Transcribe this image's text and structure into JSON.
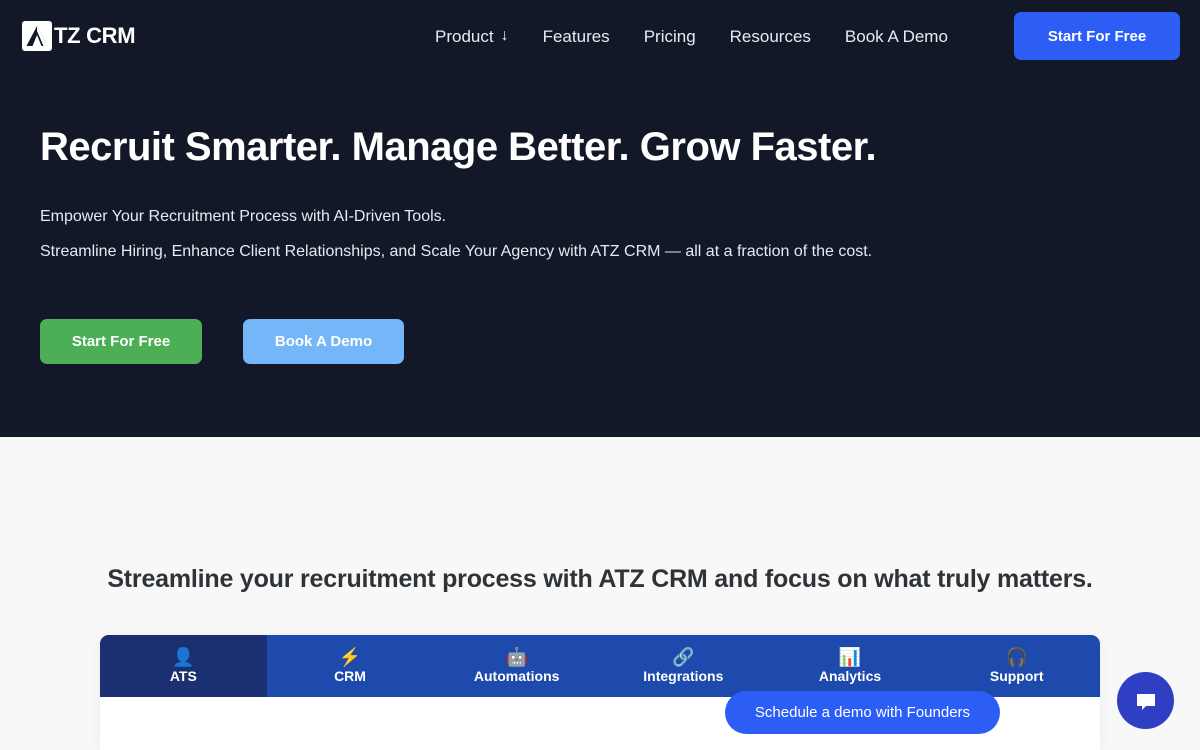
{
  "brand": {
    "name": "TZ CRM",
    "logo_icon": "atz-triangle-logo-icon"
  },
  "header": {
    "nav_items": [
      {
        "label": "Product",
        "has_dropdown": true,
        "dropdown_glyph": "↓"
      },
      {
        "label": "Features",
        "has_dropdown": false
      },
      {
        "label": "Pricing",
        "has_dropdown": false
      },
      {
        "label": "Resources",
        "has_dropdown": false
      },
      {
        "label": "Book A Demo",
        "has_dropdown": false
      }
    ],
    "cta_label": "Start For Free"
  },
  "hero": {
    "title": "Recruit Smarter. Manage Better. Grow Faster.",
    "subtitle_line1": "Empower Your Recruitment Process with AI-Driven Tools.",
    "subtitle_line2": "Streamline Hiring, Enhance Client Relationships, and Scale Your Agency with ATZ CRM — all at a fraction of the cost.",
    "primary_button": "Start For Free",
    "secondary_button": "Book A Demo"
  },
  "features_section": {
    "heading": "Streamline your recruitment process with ATZ CRM and focus on what truly matters.",
    "tabs": [
      {
        "label": "ATS",
        "icon": "bust-in-silhouette-icon",
        "glyph": "👤",
        "active": true
      },
      {
        "label": "CRM",
        "icon": "lightning-bolt-icon",
        "glyph": "⚡",
        "active": false
      },
      {
        "label": "Automations",
        "icon": "robot-icon",
        "glyph": "🤖",
        "active": false
      },
      {
        "label": "Integrations",
        "icon": "link-chain-icon",
        "glyph": "🔗",
        "active": false
      },
      {
        "label": "Analytics",
        "icon": "bar-chart-icon",
        "glyph": "📊",
        "active": false
      },
      {
        "label": "Support",
        "icon": "headphones-icon",
        "glyph": "🎧",
        "active": false
      }
    ]
  },
  "floating": {
    "demo_pill_label": "Schedule a demo with Founders",
    "chat_icon": "chat-bubble-icon"
  },
  "colors": {
    "hero_background": "#121828",
    "light_background": "#f8f8f8",
    "brand_blue": "#2c5ef5",
    "tabbar_blue": "#1f4aad",
    "tab_active_blue": "#1a3070",
    "green_button": "#4caf55",
    "lightblue_button": "#74b6f7",
    "chat_widget_blue": "#2f3fc4"
  }
}
